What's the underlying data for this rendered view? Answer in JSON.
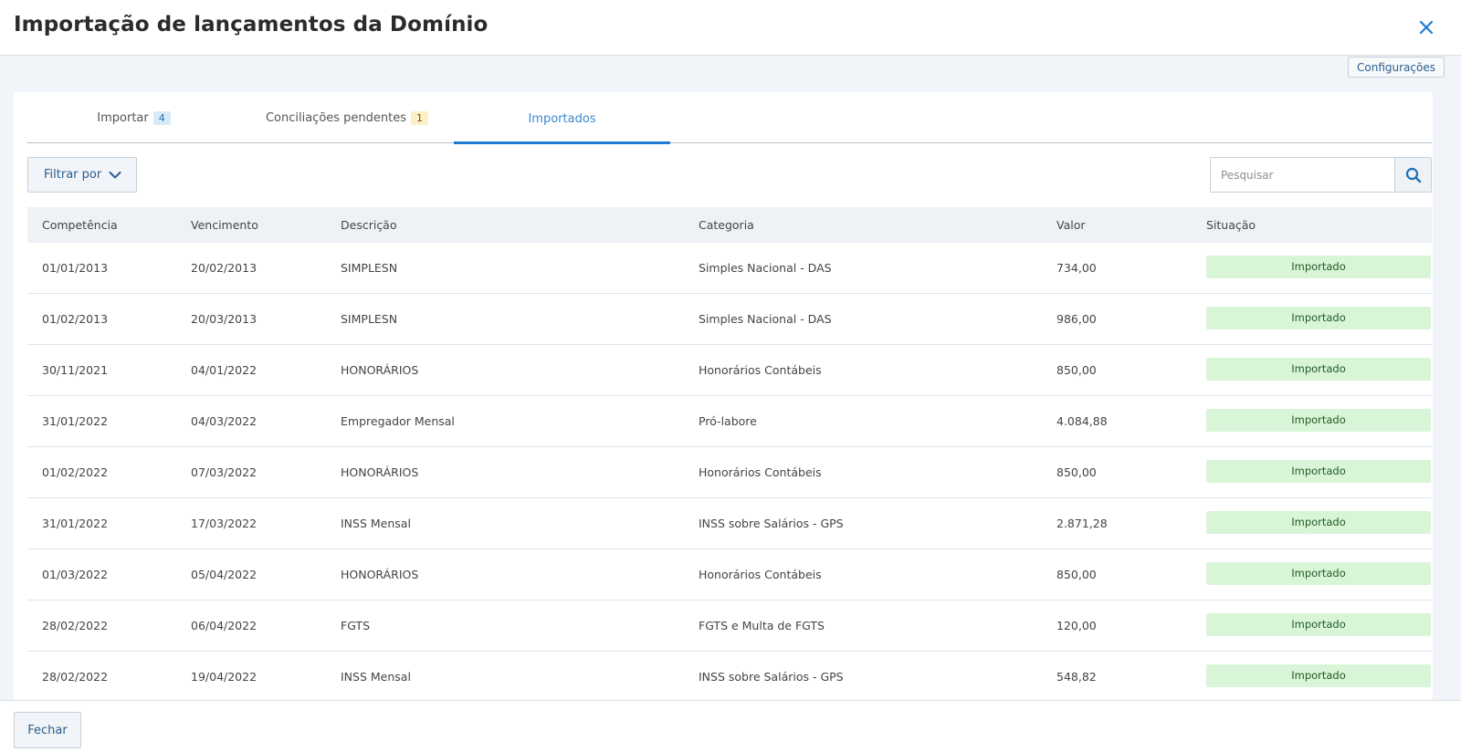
{
  "header": {
    "title": "Importação de lançamentos da Domínio",
    "close_icon": "close-icon"
  },
  "config_button": "Configurações",
  "tabs": [
    {
      "label": "Importar",
      "badge": "4",
      "badge_color": "#d6ebfa"
    },
    {
      "label": "Conciliações pendentes",
      "badge": "1",
      "badge_color": "#fdf0c7"
    },
    {
      "label": "Importados",
      "active": true
    }
  ],
  "filter": {
    "label": "Filtrar por",
    "icon": "chevron-down-icon"
  },
  "search": {
    "placeholder": "Pesquisar",
    "value": "",
    "icon": "search-icon"
  },
  "table": {
    "columns": [
      "Competência",
      "Vencimento",
      "Descrição",
      "Categoria",
      "Valor",
      "Situação"
    ],
    "rows": [
      [
        "01/01/2013",
        "20/02/2013",
        "SIMPLESN",
        "Simples Nacional - DAS",
        "734,00",
        "Importado"
      ],
      [
        "01/02/2013",
        "20/03/2013",
        "SIMPLESN",
        "Simples Nacional - DAS",
        "986,00",
        "Importado"
      ],
      [
        "30/11/2021",
        "04/01/2022",
        "HONORÁRIOS",
        "Honorários Contábeis",
        "850,00",
        "Importado"
      ],
      [
        "31/01/2022",
        "04/03/2022",
        "Empregador Mensal",
        "Pró-labore",
        "4.084,88",
        "Importado"
      ],
      [
        "01/02/2022",
        "07/03/2022",
        "HONORÁRIOS",
        "Honorários Contábeis",
        "850,00",
        "Importado"
      ],
      [
        "31/01/2022",
        "17/03/2022",
        "INSS Mensal",
        "INSS sobre Salários - GPS",
        "2.871,28",
        "Importado"
      ],
      [
        "01/03/2022",
        "05/04/2022",
        "HONORÁRIOS",
        "Honorários Contábeis",
        "850,00",
        "Importado"
      ],
      [
        "28/02/2022",
        "06/04/2022",
        "FGTS",
        "FGTS e Multa de FGTS",
        "120,00",
        "Importado"
      ],
      [
        "28/02/2022",
        "19/04/2022",
        "INSS Mensal",
        "INSS sobre Salários - GPS",
        "548,82",
        "Importado"
      ]
    ]
  },
  "footer": {
    "close_label": "Fechar"
  },
  "colors": {
    "accent": "#1f7bd4",
    "status_bg": "#d8f5d8"
  }
}
